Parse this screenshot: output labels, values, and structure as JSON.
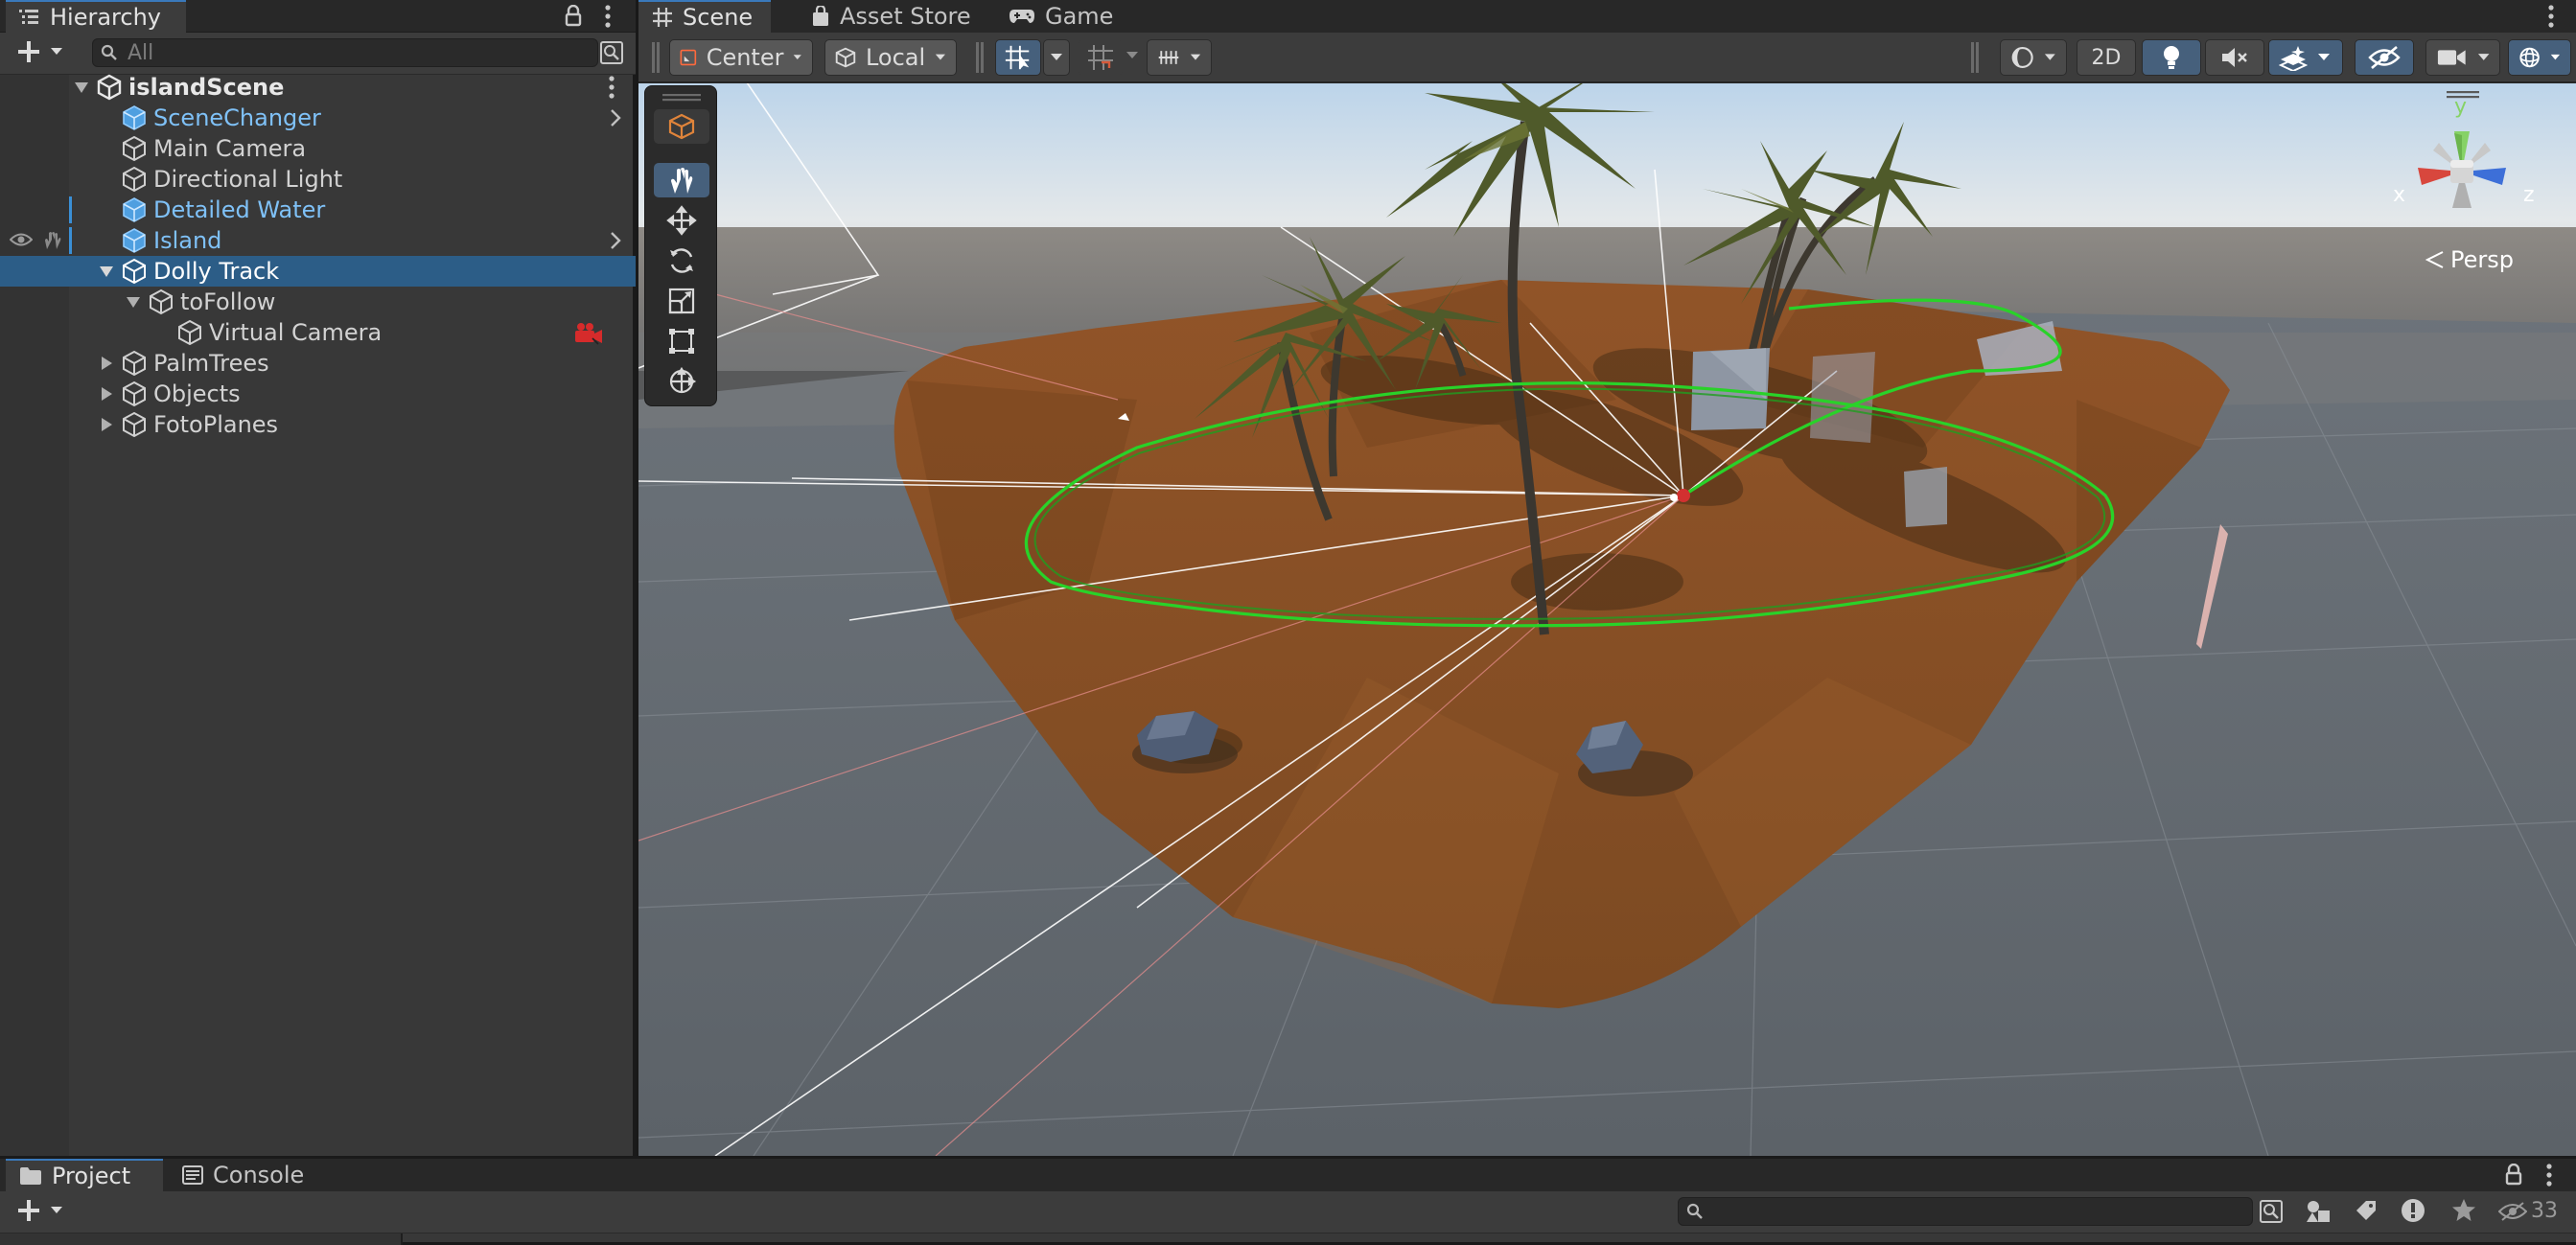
{
  "hierarchy": {
    "tab_label": "Hierarchy",
    "search_placeholder": "All",
    "scene_name": "islandScene",
    "items": [
      {
        "label": "SceneChanger"
      },
      {
        "label": "Main Camera"
      },
      {
        "label": "Directional Light"
      },
      {
        "label": "Detailed Water"
      },
      {
        "label": "Island"
      },
      {
        "label": "Dolly Track"
      },
      {
        "label": "toFollow"
      },
      {
        "label": "Virtual Camera"
      },
      {
        "label": "PalmTrees"
      },
      {
        "label": "Objects"
      },
      {
        "label": "FotoPlanes"
      }
    ]
  },
  "scene_tabs": {
    "scene": "Scene",
    "asset_store": "Asset Store",
    "game": "Game"
  },
  "scene_toolbar": {
    "pivot_mode": "Center",
    "pivot_rotation": "Local",
    "mode_2d": "2D"
  },
  "gizmo": {
    "axis_x": "x",
    "axis_y": "y",
    "axis_z": "z",
    "projection": "Persp"
  },
  "bottom": {
    "tab_project": "Project",
    "tab_console": "Console",
    "hidden_count": "33"
  },
  "colors": {
    "selection": "#2c5d87",
    "prefab_text": "#7fc1f7",
    "dolly_track": "#25d025",
    "sand": "#8a5227",
    "axis_x": "#d8473d",
    "axis_y": "#86d266",
    "axis_z": "#3d6fd8"
  }
}
